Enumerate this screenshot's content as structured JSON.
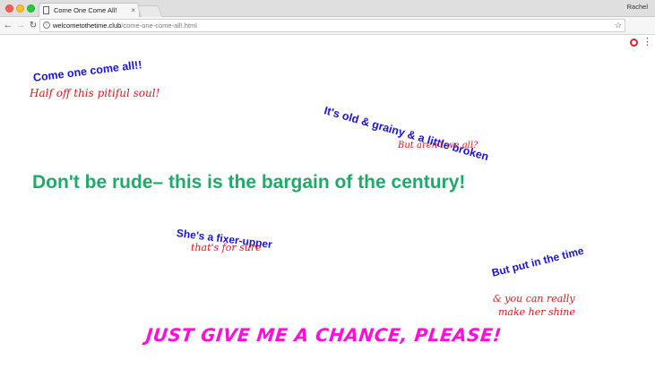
{
  "browser": {
    "tab_title": "Come One Come All!",
    "tab_close": "×",
    "profile_name": "Rachel",
    "url_domain": "welcometothetime.club",
    "url_path": "/come-one-come-all!.html",
    "icons": [
      "back-arrow-icon",
      "forward-arrow-icon",
      "reload-icon",
      "info-icon",
      "star-icon",
      "opera-icon",
      "menu-icon"
    ]
  },
  "page": {
    "lines": {
      "come_one": "Come one come all!!",
      "half_off": "Half off this pitiful soul!",
      "old_grainy": "It's old & grainy & a little broken",
      "arent_we_all": "But aren't we all?",
      "dont_be_rude": "Don't be rude– this is the bargain of the century!",
      "fixer_upper": "She's a fixer-upper",
      "for_sure": "that's for sure",
      "put_in_time": "But put in the time",
      "you_can_really": "& you can really",
      "make_her_shine": "make her shine",
      "give_me_chance": "JUST GIVE ME A CHANCE, PLEASE!"
    },
    "colors": {
      "blue": "#1a14d6",
      "red": "#e0161e",
      "green": "#1faa6a",
      "magenta": "#ff10d8"
    }
  }
}
